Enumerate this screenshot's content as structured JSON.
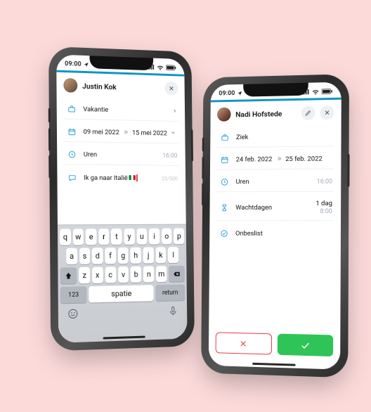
{
  "statusbar": {
    "time": "09:00"
  },
  "left": {
    "user": "Justin Kok",
    "rows": {
      "type": "Vakantie",
      "date_start": "09 mei 2022",
      "date_end": "15 mei 2022",
      "hours_label": "Uren",
      "hours_value": "16:00",
      "message": "Ik ga naar Italië",
      "message_counter": "23/500"
    },
    "keyboard": {
      "row1": [
        "q",
        "w",
        "e",
        "r",
        "t",
        "y",
        "u",
        "i",
        "o",
        "p"
      ],
      "row2": [
        "a",
        "s",
        "d",
        "f",
        "g",
        "h",
        "j",
        "k",
        "l"
      ],
      "row3": [
        "z",
        "x",
        "c",
        "v",
        "b",
        "n",
        "m"
      ],
      "num": "123",
      "space": "spatie",
      "return": "return"
    }
  },
  "right": {
    "user": "Nadi Hofstede",
    "rows": {
      "type": "Ziek",
      "date_start": "24 feb. 2022",
      "date_end": "25 feb. 2022",
      "hours_label": "Uren",
      "hours_value": "16:00",
      "wait_label": "Wachtdagen",
      "wait_value": "1 dag",
      "wait_sub": "8:00",
      "status": "Onbeslist"
    }
  }
}
